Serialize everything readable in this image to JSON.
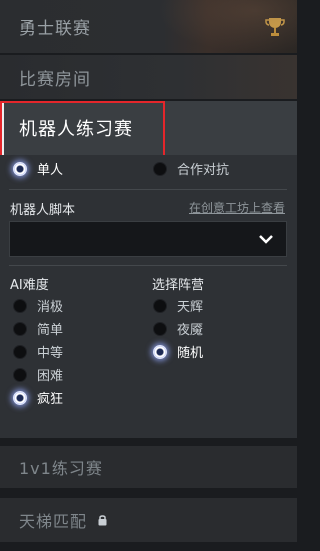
{
  "tabs": {
    "top_label": "勇士联赛",
    "room_label": "比赛房间",
    "active_label": "机器人练习赛",
    "one_v_one_label": "1v1练习赛",
    "ladder_label": "天梯匹配"
  },
  "icons": {
    "trophy": "trophy-icon",
    "chevron": "chevron-down-icon",
    "lock": "lock-icon"
  },
  "mode": {
    "options": [
      "单人",
      "合作对抗"
    ],
    "selected": "单人"
  },
  "script": {
    "label": "机器人脚本",
    "workshop_link": "在创意工坊上查看",
    "value": ""
  },
  "difficulty": {
    "label": "AI难度",
    "options": [
      "消极",
      "简单",
      "中等",
      "困难",
      "疯狂"
    ],
    "selected": "疯狂"
  },
  "faction": {
    "label": "选择阵营",
    "options": [
      "天辉",
      "夜魇",
      "随机"
    ],
    "selected": "随机"
  },
  "colors": {
    "highlight": "#e4262b",
    "selected_glow": "#b9c4f5"
  }
}
